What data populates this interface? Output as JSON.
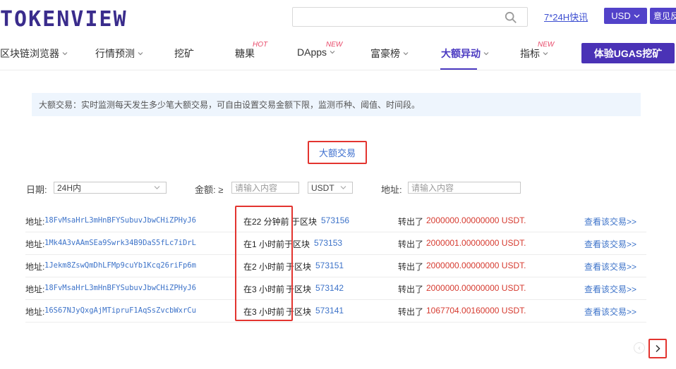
{
  "header": {
    "logo": "TOKENVIEW",
    "search_placeholder": "",
    "quick_link": "7*24H快讯",
    "currency": "USD",
    "feedback": "意见反馈"
  },
  "nav": {
    "items": [
      {
        "label": "区块链浏览器",
        "chevron": true
      },
      {
        "label": "行情预测",
        "chevron": true
      },
      {
        "label": "挖矿",
        "chevron": false
      },
      {
        "label": "糖果",
        "chevron": false,
        "badge": "HOT"
      },
      {
        "label": "DApps",
        "chevron": true,
        "badge": "NEW"
      },
      {
        "label": "富豪榜",
        "chevron": true
      },
      {
        "label": "大额异动",
        "chevron": true,
        "active": true
      },
      {
        "label": "指标",
        "chevron": true,
        "badge": "NEW"
      }
    ],
    "cta": "体验UGAS挖矿"
  },
  "info_bar": "大额交易：实时监测每天发生多少笔大额交易，可自由设置交易金额下限，监测币种、阈值、时间段。",
  "section_title": "大额交易",
  "filters": {
    "date_label": "日期:",
    "date_value": "24H内",
    "amount_label": "金额: ≥",
    "amount_placeholder": "请输入内容",
    "currency_value": "USDT",
    "address_label": "地址:",
    "address_placeholder": "请输入内容"
  },
  "table": {
    "addr_label": "地址:",
    "amount_label": "转出了",
    "view_label": "查看该交易>>",
    "block_prefix": "于区块",
    "rows": [
      {
        "address": "18FvMsaHrL3mHnBFYSubuvJbwCHiZPHyJ6",
        "time": "在22 分钟前",
        "block": "573156",
        "amount": "2000000.00000000 USDT."
      },
      {
        "address": "1Mk4A3vAAmSEa9Swrk34B9DaS5fLc7iDrL",
        "time": "在1 小时前",
        "block": "573153",
        "amount": "2000001.00000000 USDT."
      },
      {
        "address": "1Jekm8ZswQmDhLFMp9cuYb1Kcq26riFp6m",
        "time": "在2 小时前",
        "block": "573151",
        "amount": "2000000.00000000 USDT."
      },
      {
        "address": "18FvMsaHrL3mHnBFYSubuvJbwCHiZPHyJ6",
        "time": "在3 小时前",
        "block": "573142",
        "amount": "2000000.00000000 USDT."
      },
      {
        "address": "16S67NJyQxgAjMTipruF1AqSsZvcbWxrCu",
        "time": "在3 小时前",
        "block": "573141",
        "amount": "1067704.00160000 USDT."
      }
    ]
  },
  "pagination": {
    "prev": "‹",
    "next": "›"
  },
  "colors": {
    "brand": "#4a39c1",
    "link": "#3d73c9",
    "amount": "#d63a2f",
    "highlight": "#e3342f"
  }
}
